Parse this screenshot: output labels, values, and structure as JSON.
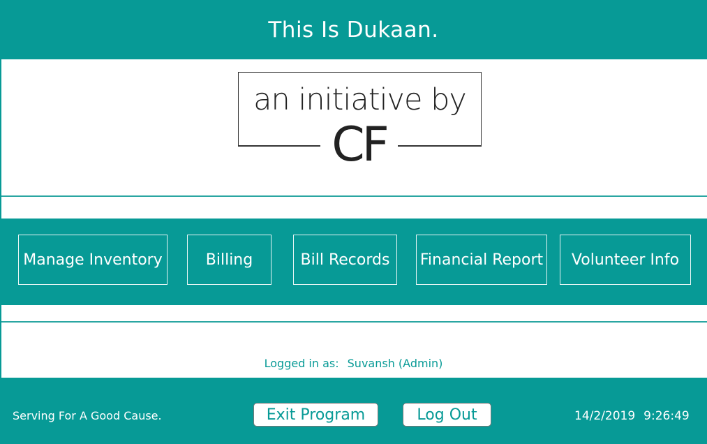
{
  "header": {
    "title": "This Is Dukaan."
  },
  "logo": {
    "line1": "an initiative by",
    "line2": "CF"
  },
  "nav": {
    "buttons": [
      {
        "label": "Manage Inventory"
      },
      {
        "label": "Billing"
      },
      {
        "label": "Bill Records"
      },
      {
        "label": "Financial Report"
      },
      {
        "label": "Volunteer Info"
      }
    ]
  },
  "session": {
    "logged_in_label": "Logged in as:",
    "user": "Suvansh (Admin)"
  },
  "footer": {
    "tagline": "Serving For A Good Cause.",
    "exit_label": "Exit Program",
    "logout_label": "Log Out",
    "date": "14/2/2019",
    "time": "9:26:49"
  },
  "colors": {
    "brand": "#079a96",
    "divider": "#2aa6a2",
    "background": "#ffffff"
  }
}
